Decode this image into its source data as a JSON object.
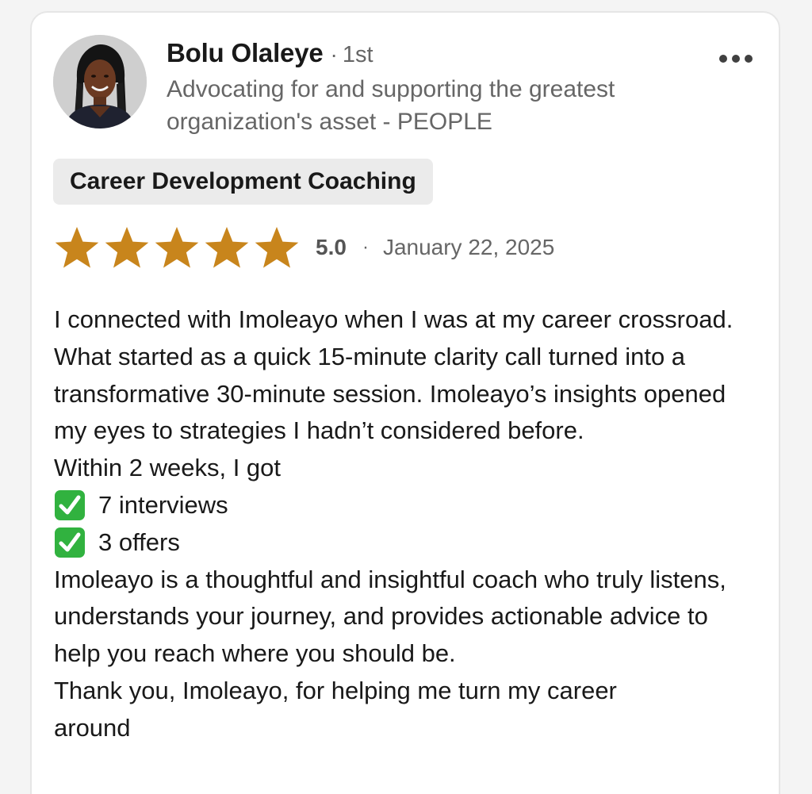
{
  "reviewer": {
    "name": "Bolu Olaleye",
    "connection_separator": "·",
    "connection_degree": "1st",
    "headline": "Advocating for and supporting the greatest organization's asset - PEOPLE",
    "avatar_icon": "profile-photo"
  },
  "menu": {
    "icon": "more-horizontal-icon"
  },
  "service": {
    "label": "Career Development Coaching"
  },
  "rating": {
    "stars": 5,
    "max_stars": 5,
    "value_text": "5.0",
    "separator": "·",
    "date": "January 22, 2025",
    "star_color": "#c8851c"
  },
  "review": {
    "paragraph_1": "I connected with Imoleayo when I was at my career crossroad. What started as a quick 15-minute clarity call turned into a transformative 30-minute session. Imoleayo’s insights opened my eyes to strategies I hadn’t considered before.",
    "lead_in": "Within 2 weeks, I got",
    "results": [
      {
        "icon": "check-mark-button-icon",
        "text": "7 interviews"
      },
      {
        "icon": "check-mark-button-icon",
        "text": "3 offers"
      }
    ],
    "paragraph_2": "Imoleayo is a thoughtful and insightful coach who truly listens, understands your journey, and provides actionable advice to help you reach where you should be.",
    "closing": "Thank you, Imoleayo, for helping me turn my career around"
  },
  "colors": {
    "name_text": "#191919",
    "secondary_text": "#666666",
    "tag_background": "#ebebeb",
    "check_green": "#31b23f"
  }
}
